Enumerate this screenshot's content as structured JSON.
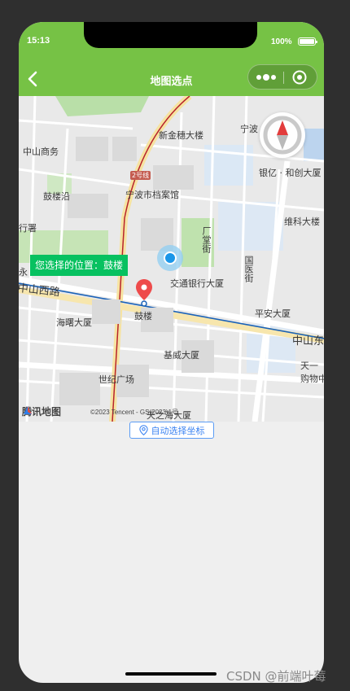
{
  "status_bar": {
    "time": "15:13",
    "battery": "100%"
  },
  "nav": {
    "title": "地图选点"
  },
  "map": {
    "callout": "您选择的位置：鼓楼",
    "labels": {
      "xinjinsui": "新金穗大楼",
      "ningbo": "宁波",
      "zhongshan_shangwu": "中山商务",
      "yinyi": "银亿 · 和创大厦",
      "gulouyan": "鼓楼沿",
      "dangan": "宁波市档案馆",
      "weike": "维科大楼",
      "hangshu": "行署",
      "yong": "永",
      "zhongshan_xilu": "中山西路",
      "jiaotong": "交通银行大厦",
      "tang_jie": "厂堂街",
      "guoyi_jie": "国医街",
      "haishu": "海曙大厦",
      "gulou": "鼓楼",
      "pingan": "平安大厦",
      "zhongshan_dong": "中山东",
      "jiwei": "基威大厦",
      "tianyi": "天一",
      "gouwu": "购物中",
      "shiji": "世纪广场",
      "tianzhi": "天之海大厦",
      "metro": "2号线"
    },
    "logo": "腾讯地图",
    "copyright": "©2023 Tencent - GS(2023)1号"
  },
  "auto_button": {
    "label": "自动选择坐标"
  },
  "watermark": "CSDN @前端叶莓",
  "colors": {
    "header": "#76c245",
    "callout": "#07c160",
    "auto_button": "#3c84f2"
  }
}
